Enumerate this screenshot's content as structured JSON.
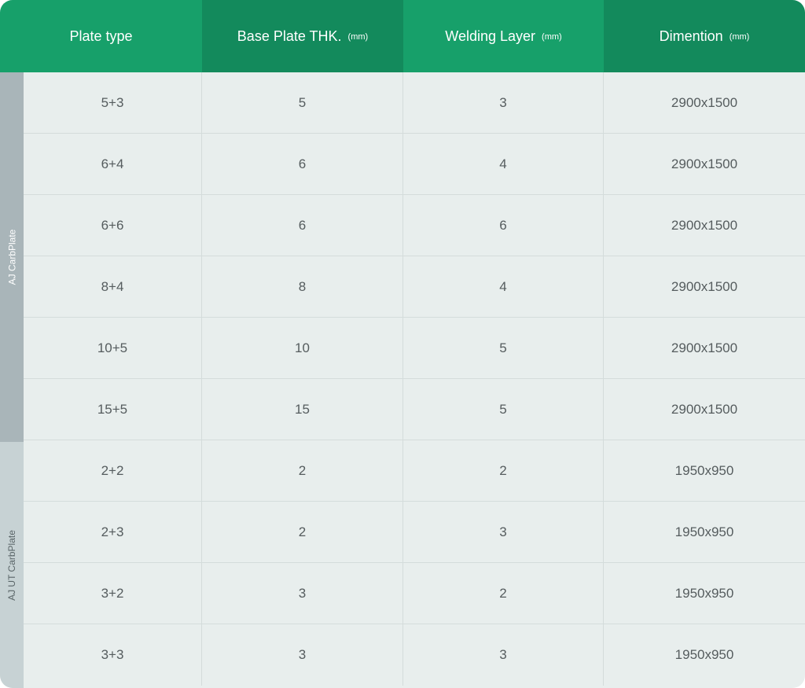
{
  "header": {
    "col0": {
      "label": "Plate type",
      "unit": ""
    },
    "col1": {
      "label": "Base Plate THK.",
      "unit": "(mm)"
    },
    "col2": {
      "label": "Welding Layer",
      "unit": "(mm)"
    },
    "col3": {
      "label": "Dimention",
      "unit": "(mm)"
    }
  },
  "groups": [
    {
      "label": "AJ CarbPlate"
    },
    {
      "label": "AJ UT CarbPlate"
    }
  ],
  "rows": [
    {
      "plate_type": "5+3",
      "base_thk": "5",
      "welding_layer": "3",
      "dimension": "2900x1500"
    },
    {
      "plate_type": "6+4",
      "base_thk": "6",
      "welding_layer": "4",
      "dimension": "2900x1500"
    },
    {
      "plate_type": "6+6",
      "base_thk": "6",
      "welding_layer": "6",
      "dimension": "2900x1500"
    },
    {
      "plate_type": "8+4",
      "base_thk": "8",
      "welding_layer": "4",
      "dimension": "2900x1500"
    },
    {
      "plate_type": "10+5",
      "base_thk": "10",
      "welding_layer": "5",
      "dimension": "2900x1500"
    },
    {
      "plate_type": "15+5",
      "base_thk": "15",
      "welding_layer": "5",
      "dimension": "2900x1500"
    },
    {
      "plate_type": "2+2",
      "base_thk": "2",
      "welding_layer": "2",
      "dimension": "1950x950"
    },
    {
      "plate_type": "2+3",
      "base_thk": "2",
      "welding_layer": "3",
      "dimension": "1950x950"
    },
    {
      "plate_type": "3+2",
      "base_thk": "3",
      "welding_layer": "2",
      "dimension": "1950x950"
    },
    {
      "plate_type": "3+3",
      "base_thk": "3",
      "welding_layer": "3",
      "dimension": "1950x950"
    }
  ],
  "colors": {
    "header_green": "#17a06a",
    "header_dark_green": "#138a5c",
    "group1_bg": "#a9b5b9",
    "group2_bg": "#c7d2d4",
    "row_bg": "#e8eeed"
  }
}
